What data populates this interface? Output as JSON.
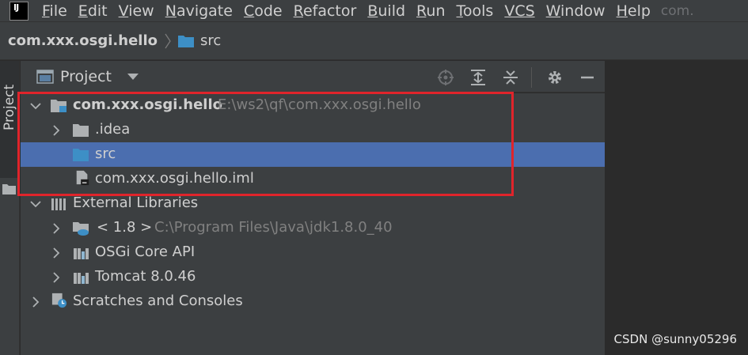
{
  "menubar": {
    "logo_text": "IJ",
    "items": [
      {
        "label": "File",
        "ul": "F",
        "rest": "ile"
      },
      {
        "label": "Edit",
        "ul": "E",
        "rest": "dit"
      },
      {
        "label": "View",
        "ul": "V",
        "rest": "iew"
      },
      {
        "label": "Navigate",
        "ul": "N",
        "rest": "avigate"
      },
      {
        "label": "Code",
        "ul": "C",
        "rest": "ode"
      },
      {
        "label": "Refactor",
        "ul": "R",
        "rest": "efactor"
      },
      {
        "label": "Build",
        "ul": "B",
        "rest": "uild"
      },
      {
        "label": "Run",
        "ul": "R",
        "rest": "un"
      },
      {
        "label": "Tools",
        "ul": "T",
        "rest": "ools"
      },
      {
        "label": "VCS",
        "ul": "",
        "rest": "VCS"
      },
      {
        "label": "Window",
        "ul": "W",
        "rest": "indow"
      },
      {
        "label": "Help",
        "ul": "H",
        "rest": "elp"
      }
    ],
    "window_title_fragment": "com."
  },
  "breadcrumb": {
    "project": "com.xxx.osgi.hello",
    "folder": "src"
  },
  "side_tab": {
    "label": "Project"
  },
  "panel": {
    "title": "Project"
  },
  "tree": {
    "root": {
      "label": "com.xxx.osgi.hello",
      "path": "E:\\ws2\\qf\\com.xxx.osgi.hello"
    },
    "idea": {
      "label": ".idea"
    },
    "src": {
      "label": "src"
    },
    "iml": {
      "label": "com.xxx.osgi.hello.iml"
    },
    "ext_libs": {
      "label": "External Libraries"
    },
    "jdk": {
      "label": "< 1.8 >",
      "path": "C:\\Program Files\\Java\\jdk1.8.0_40"
    },
    "osgi": {
      "label": "OSGi Core API"
    },
    "tomcat": {
      "label": "Tomcat 8.0.46"
    },
    "scratches": {
      "label": "Scratches and Consoles"
    }
  },
  "watermark": "CSDN @sunny05296",
  "colors": {
    "selection": "#4b6eaf",
    "highlight_box": "#e0242b",
    "folder_blue": "#3d8fc6"
  }
}
